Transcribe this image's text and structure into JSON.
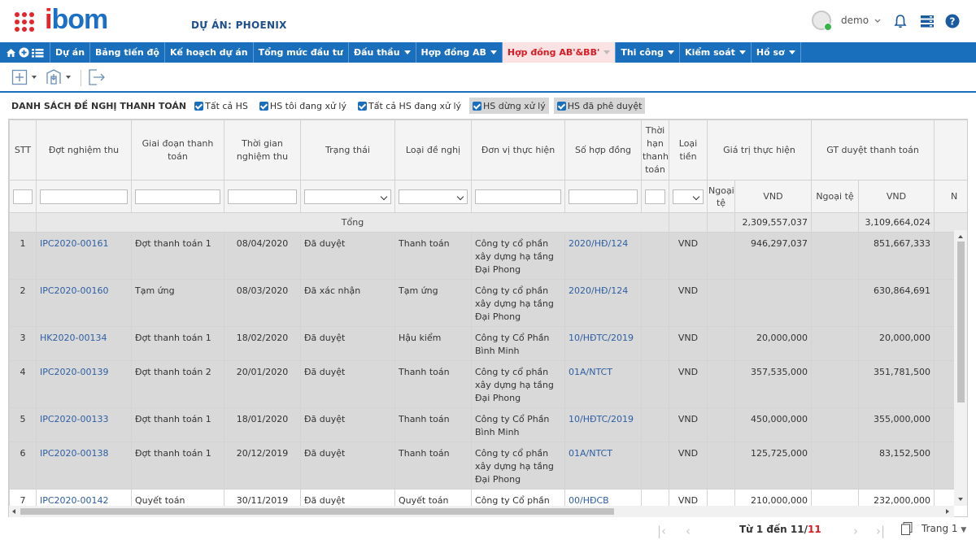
{
  "header": {
    "logo": "bom",
    "logo_lead": "i",
    "project_label": "DỰ ÁN: PHOENIX",
    "user": "demo"
  },
  "nav": {
    "items": [
      {
        "label": "Dự án",
        "dropdown": false,
        "active": false
      },
      {
        "label": "Bảng tiến độ",
        "dropdown": false,
        "active": false
      },
      {
        "label": "Kế hoạch dự án",
        "dropdown": false,
        "active": false
      },
      {
        "label": "Tổng mức đầu tư",
        "dropdown": false,
        "active": false
      },
      {
        "label": "Đấu thầu",
        "dropdown": true,
        "active": false
      },
      {
        "label": "Hợp đồng AB",
        "dropdown": true,
        "active": false
      },
      {
        "label": "Hợp đồng AB'&BB'",
        "dropdown": true,
        "active": true
      },
      {
        "label": "Thi công",
        "dropdown": true,
        "active": false
      },
      {
        "label": "Kiểm soát",
        "dropdown": true,
        "active": false
      },
      {
        "label": "Hồ sơ",
        "dropdown": true,
        "active": false
      }
    ]
  },
  "filter": {
    "title": "DANH SÁCH ĐỀ NGHỊ THANH TOÁN",
    "checkboxes": [
      {
        "label": "Tất cả HS",
        "checked": true
      },
      {
        "label": "HS tôi đang xử lý",
        "checked": true
      },
      {
        "label": "Tất cả HS đang xử lý",
        "checked": true
      },
      {
        "label": "HS dừng xử lý",
        "checked": true
      },
      {
        "label": "HS đã phê duyệt",
        "checked": true
      }
    ]
  },
  "table": {
    "headers": {
      "stt": "STT",
      "dot": "Đợt nghiệm thu",
      "giai_doan": "Giai đoạn thanh toán",
      "thoi_gian": "Thời gian nghiệm thu",
      "trang_thai": "Trạng thái",
      "loai_de_nghi": "Loại đề nghị",
      "don_vi": "Đơn vị thực hiện",
      "so_hop_dong": "Số hợp đồng",
      "thoi_han": "Thời hạn thanh toán",
      "loai_tien": "Loại tiền",
      "gia_tri": "Giá trị thực hiện",
      "gt_duyet": "GT duyệt thanh toán",
      "ngoai_te": "Ngoại tệ",
      "vnd": "VND",
      "ngoai_te2": "Ngoại tệ",
      "vnd2": "VND",
      "next_col": "N"
    },
    "total": {
      "label": "Tổng",
      "gia_tri_vnd": "2,309,557,037",
      "gt_duyet_vnd": "3,109,664,024"
    },
    "rows": [
      {
        "stt": "1",
        "dot": "IPC2020-00161",
        "giai_doan": "Đợt thanh toán 1",
        "thoi_gian": "08/04/2020",
        "trang_thai": "Đã duyệt",
        "loai": "Thanh toán",
        "don_vi": "Công ty cổ phần xây dựng hạ tầng Đại Phong",
        "hop_dong": "2020/HĐ/124",
        "loai_tien": "VND",
        "gia_tri": "946,297,037",
        "gt_duyet": "851,667,333"
      },
      {
        "stt": "2",
        "dot": "IPC2020-00160",
        "giai_doan": "Tạm ứng",
        "thoi_gian": "08/03/2020",
        "trang_thai": "Đã xác nhận",
        "loai": "Tạm ứng",
        "don_vi": "Công ty cổ phần xây dựng hạ tầng Đại Phong",
        "hop_dong": "2020/HĐ/124",
        "loai_tien": "VND",
        "gia_tri": "",
        "gt_duyet": "630,864,691"
      },
      {
        "stt": "3",
        "dot": "HK2020-00134",
        "giai_doan": "Đợt thanh toán 1",
        "thoi_gian": "18/02/2020",
        "trang_thai": "Đã duyệt",
        "loai": "Hậu kiểm",
        "don_vi": "Công ty Cổ Phần Bình Minh",
        "hop_dong": "10/HĐTC/2019",
        "loai_tien": "VND",
        "gia_tri": "20,000,000",
        "gt_duyet": "20,000,000"
      },
      {
        "stt": "4",
        "dot": "IPC2020-00139",
        "giai_doan": "Đợt thanh toán 2",
        "thoi_gian": "20/01/2020",
        "trang_thai": "Đã duyệt",
        "loai": "Thanh toán",
        "don_vi": "Công ty cổ phần xây dựng hạ tầng Đại Phong",
        "hop_dong": "01A/NTCT",
        "loai_tien": "VND",
        "gia_tri": "357,535,000",
        "gt_duyet": "351,781,500"
      },
      {
        "stt": "5",
        "dot": "IPC2020-00133",
        "giai_doan": "Đợt thanh toán 1",
        "thoi_gian": "18/01/2020",
        "trang_thai": "Đã duyệt",
        "loai": "Thanh toán",
        "don_vi": "Công ty Cổ Phần Bình Minh",
        "hop_dong": "10/HĐTC/2019",
        "loai_tien": "VND",
        "gia_tri": "450,000,000",
        "gt_duyet": "355,000,000"
      },
      {
        "stt": "6",
        "dot": "IPC2020-00138",
        "giai_doan": "Đợt thanh toán 1",
        "thoi_gian": "20/12/2019",
        "trang_thai": "Đã duyệt",
        "loai": "Thanh toán",
        "don_vi": "Công ty cổ phần xây dựng hạ tầng Đại Phong",
        "hop_dong": "01A/NTCT",
        "loai_tien": "VND",
        "gia_tri": "125,725,000",
        "gt_duyet": "83,152,500"
      },
      {
        "stt": "7",
        "dot": "IPC2020-00142",
        "giai_doan": "Quyết toán",
        "thoi_gian": "30/11/2019",
        "trang_thai": "Đã duyệt",
        "loai": "Quyết toán",
        "don_vi": "Công ty Cổ phần",
        "hop_dong": "00/HĐCB",
        "loai_tien": "VND",
        "gia_tri": "210,000,000",
        "gt_duyet": "232,000,000"
      }
    ]
  },
  "pager": {
    "info_prefix": "Từ 1 đến 11/",
    "info_total": "11",
    "page_label": "Trang 1"
  },
  "colors": {
    "primary": "#1a6fbd",
    "brand_red": "#e3262c",
    "link": "#2e5fa3"
  }
}
